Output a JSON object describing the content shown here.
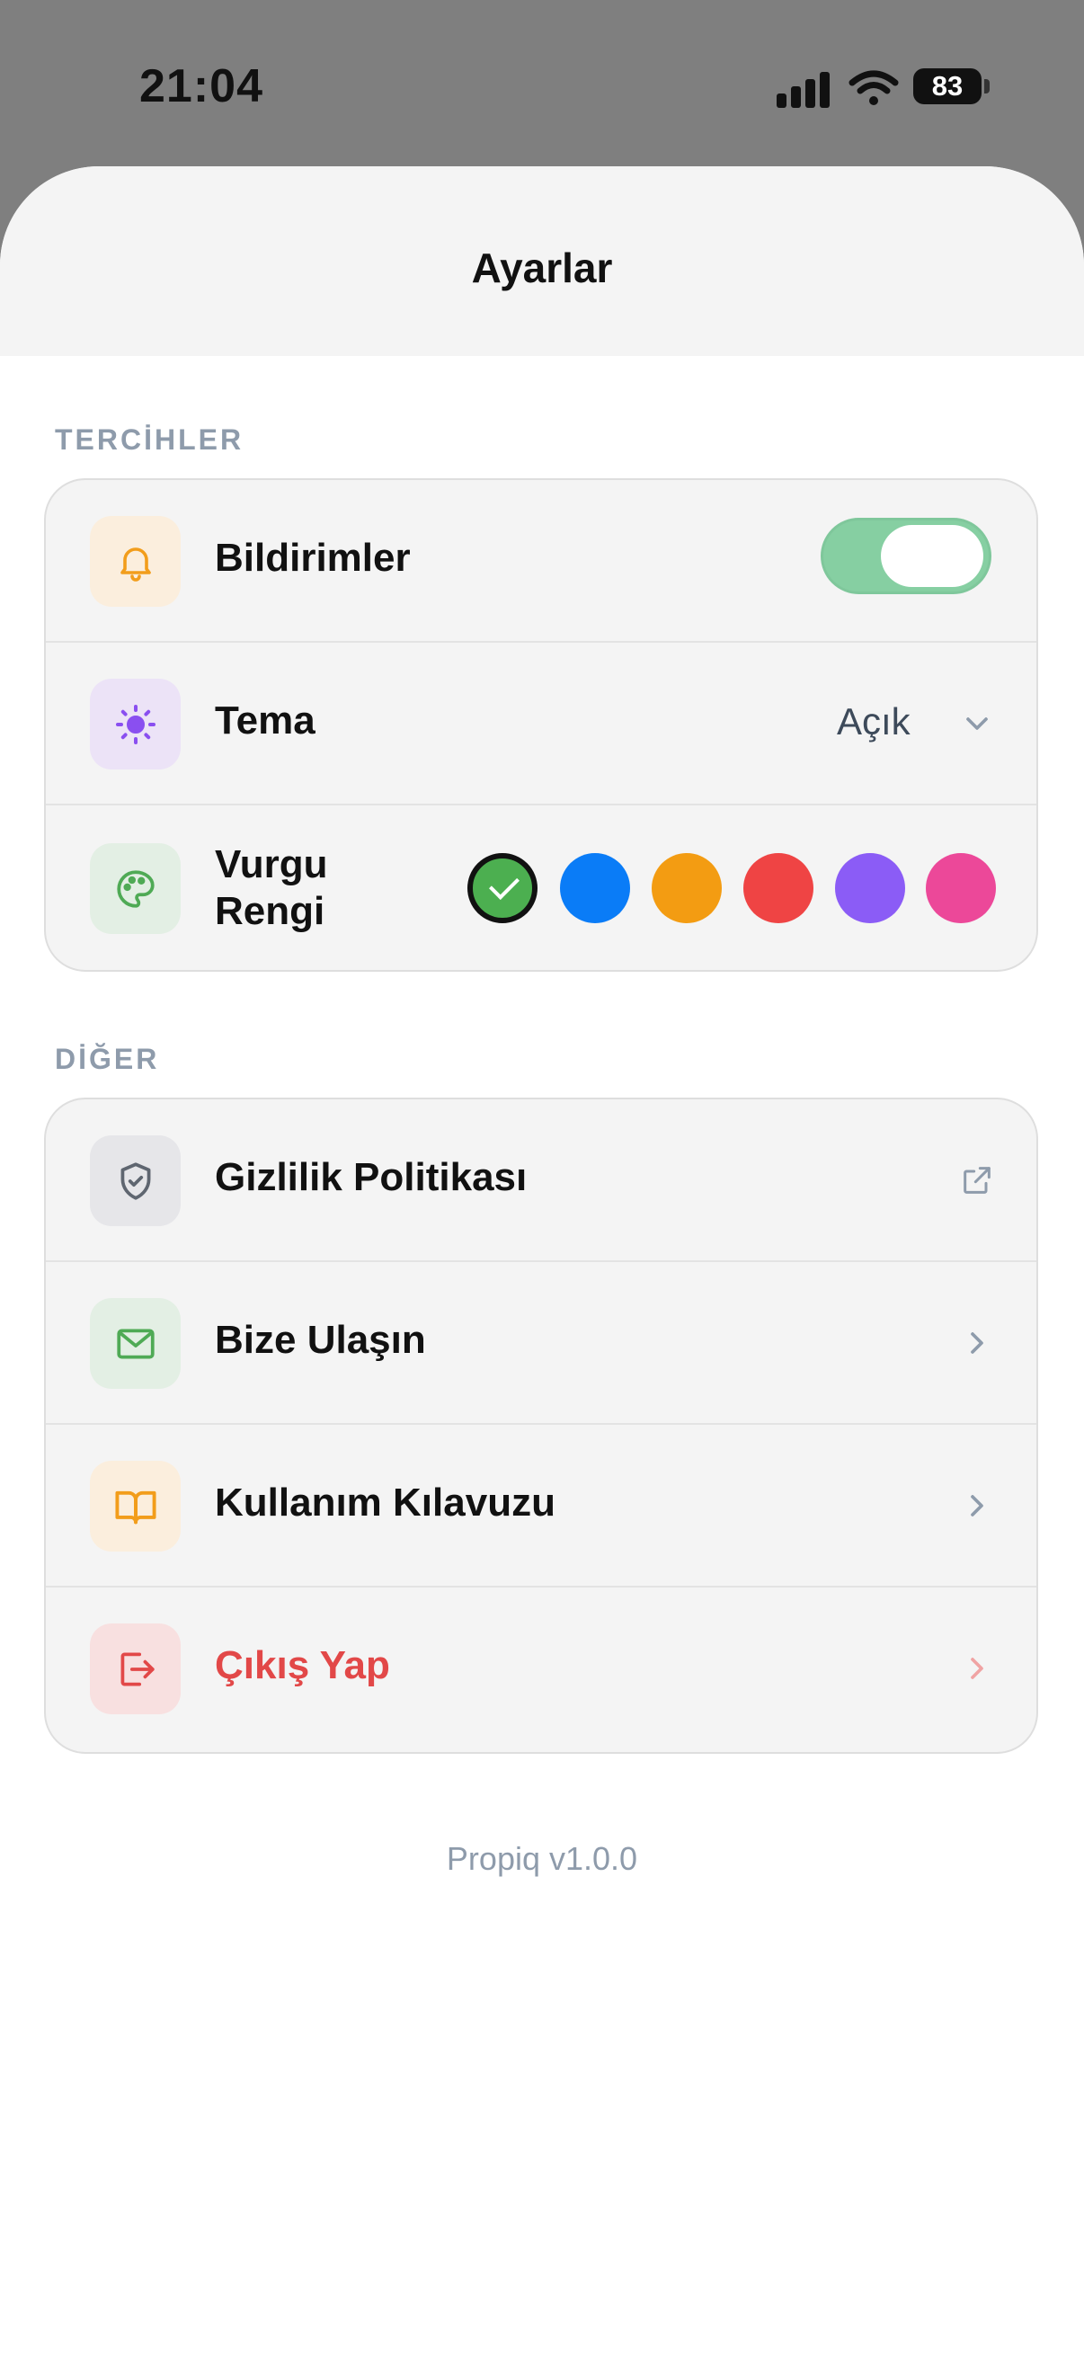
{
  "status": {
    "time": "21:04",
    "battery": "83"
  },
  "sheet": {
    "title": "Ayarlar"
  },
  "preferences": {
    "label": "TERCİHLER",
    "notifications": {
      "label": "Bildirimler",
      "enabled": true,
      "icon": "bell-icon",
      "tile_color": "#fbeedd",
      "icon_color": "#f29d1b"
    },
    "theme": {
      "label": "Tema",
      "value": "Açık",
      "icon": "sun-icon",
      "tile_color": "#ece3f7",
      "icon_color": "#8a4ff0"
    },
    "accent": {
      "label": "Vurgu Rengi",
      "icon": "palette-icon",
      "tile_color": "#e3efe4",
      "icon_color": "#4faa55",
      "colors": [
        "#4caf50",
        "#0a7cf7",
        "#f39c12",
        "#ef4444",
        "#8b5cf6",
        "#ec4899"
      ],
      "selected_index": 0
    }
  },
  "other": {
    "label": "DİĞER",
    "items": [
      {
        "label": "Gizlilik Politikası",
        "icon": "shield-check-icon",
        "action": "external-link-icon",
        "tile_color": "#e6e6e9"
      },
      {
        "label": "Bize Ulaşın",
        "icon": "mail-icon",
        "action": "chevron-right-icon",
        "tile_color": "#e3efe4"
      },
      {
        "label": "Kullanım Kılavuzu",
        "icon": "book-icon",
        "action": "chevron-right-icon",
        "tile_color": "#fbeedd"
      },
      {
        "label": "Çıkış Yap",
        "icon": "logout-icon",
        "action": "chevron-right-icon",
        "tile_color": "#f8e0e0",
        "danger": true
      }
    ]
  },
  "footer": {
    "version": "Propiq v1.0.0"
  },
  "colors": {
    "accent_green": "#4caf50",
    "danger": "#e24848",
    "muted": "#8e9bab"
  }
}
